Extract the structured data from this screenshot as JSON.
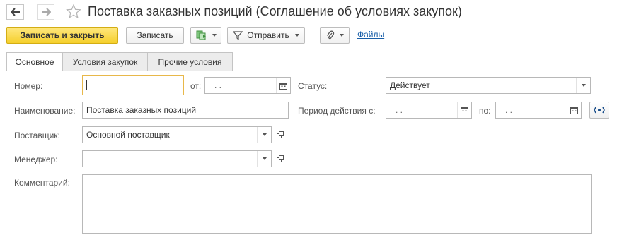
{
  "window": {
    "title": "Поставка заказных позиций (Соглашение об условиях закупок)"
  },
  "toolbar": {
    "save_close_label": "Записать и закрыть",
    "save_label": "Записать",
    "send_label": "Отправить",
    "files_link": "Файлы"
  },
  "tabs": [
    {
      "label": "Основное",
      "active": true
    },
    {
      "label": "Условия закупок",
      "active": false
    },
    {
      "label": "Прочие условия",
      "active": false
    }
  ],
  "form": {
    "number_label": "Номер:",
    "number_value": "",
    "from_label": "от:",
    "from_value": " .  .",
    "status_label": "Статус:",
    "status_value": "Действует",
    "name_label": "Наименование:",
    "name_value": "Поставка заказных позиций",
    "period_label": "Период действия с:",
    "period_from_value": " .  .",
    "period_to_label": "по:",
    "period_to_value": " .  .",
    "supplier_label": "Поставщик:",
    "supplier_value": "Основной поставщик",
    "manager_label": "Менеджер:",
    "manager_value": "",
    "comment_label": "Комментарий:",
    "comment_value": ""
  },
  "colors": {
    "primary_button": "#f5cf2b",
    "link": "#1a5fa8",
    "focus_border": "#e8b84a"
  }
}
